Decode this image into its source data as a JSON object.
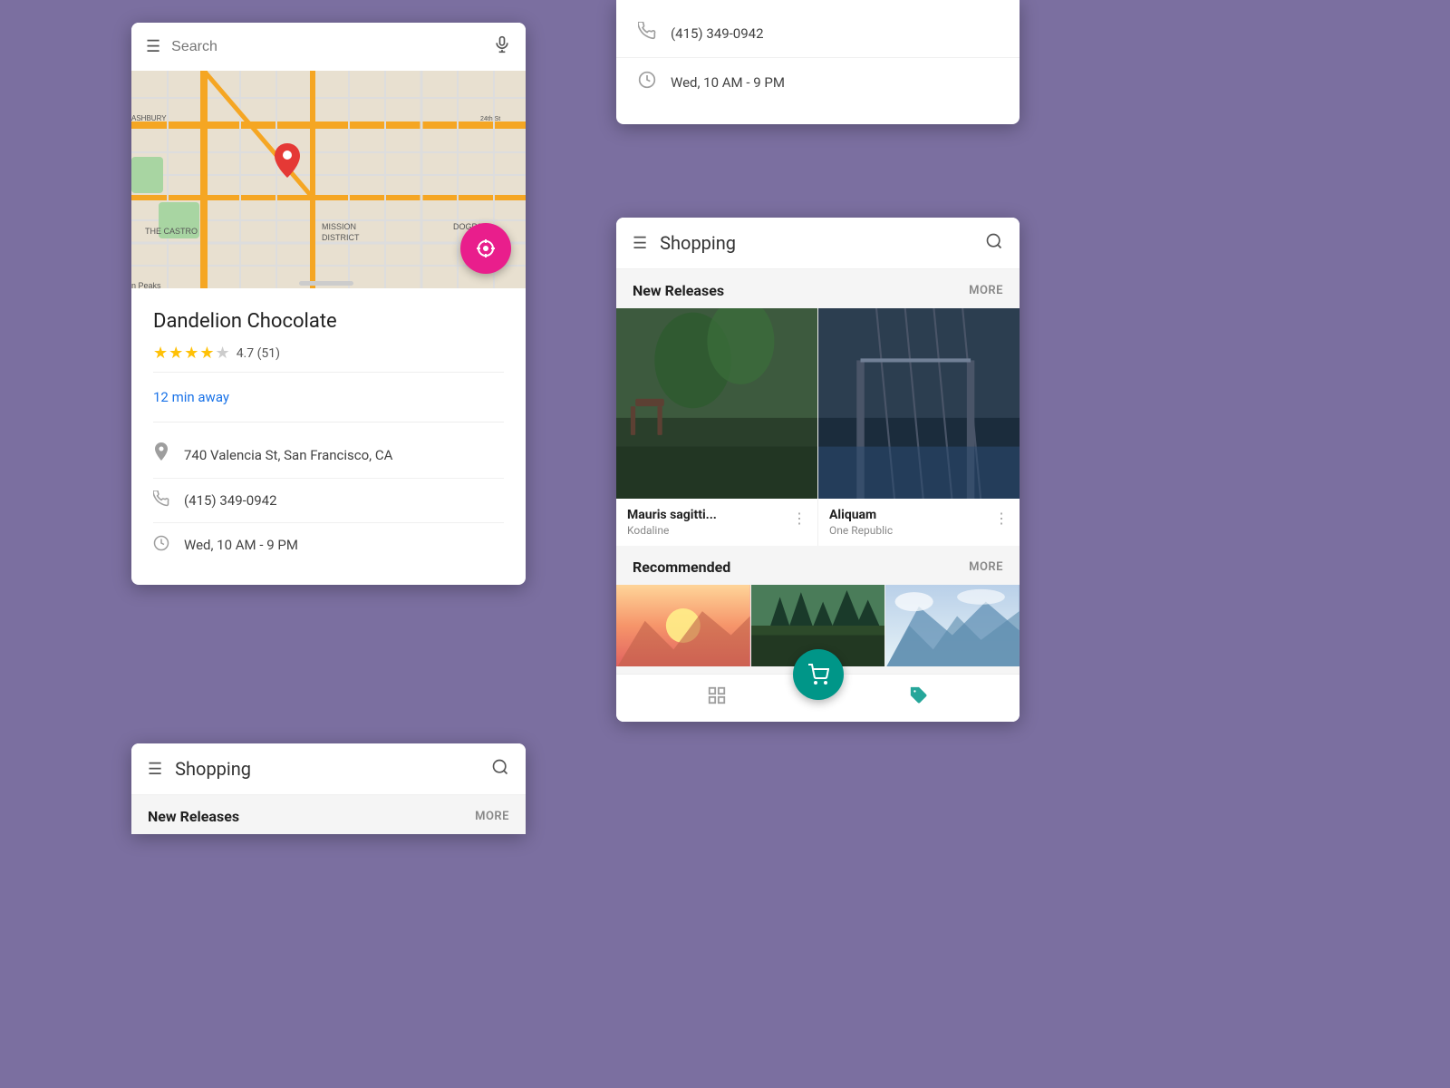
{
  "background_color": "#7b6fa0",
  "maps_card": {
    "search_placeholder": "Search",
    "place_name": "Dandelion Chocolate",
    "rating": "4.7",
    "review_count": "(51)",
    "distance": "12 min away",
    "address": "740 Valencia St, San Francisco, CA",
    "phone": "(415) 349-0942",
    "hours": "Wed, 10 AM - 9 PM",
    "stars_filled": "★★★★",
    "star_half": "★",
    "star_empty": "☆"
  },
  "top_right_card": {
    "phone": "(415) 349-0942",
    "hours": "Wed, 10 AM - 9 PM"
  },
  "shopping_large": {
    "title": "Shopping",
    "new_releases_label": "New Releases",
    "more_label": "MORE",
    "recommended_label": "Recommended",
    "products": [
      {
        "name": "Mauris sagitti...",
        "artist": "Kodaline"
      },
      {
        "name": "Aliquam",
        "artist": "One Republic"
      }
    ]
  },
  "shopping_small": {
    "title": "Shopping",
    "new_releases_label": "New Releases",
    "more_label": "MORE"
  },
  "icons": {
    "hamburger": "☰",
    "mic": "🎤",
    "search": "🔍",
    "location_pin": "📍",
    "phone": "📞",
    "clock": "🕐",
    "dots": "⋮",
    "grid": "⊞",
    "cart": "🛒",
    "tag": "🏷"
  }
}
